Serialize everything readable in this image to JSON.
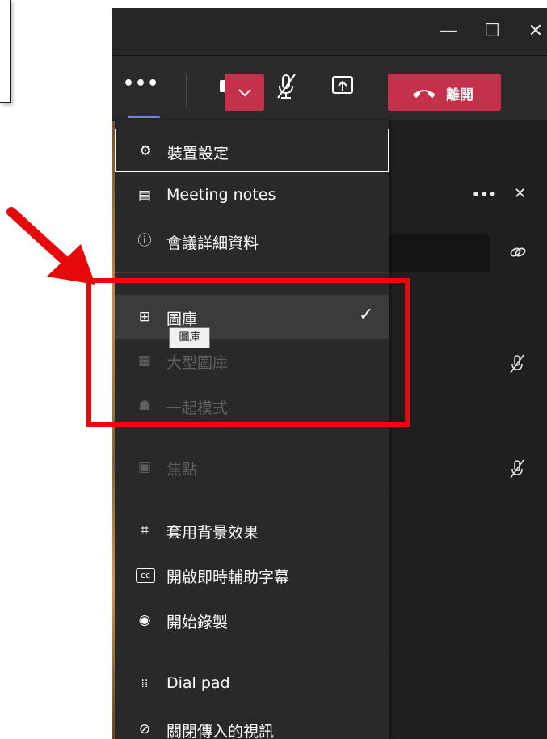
{
  "window": {
    "minimize_glyph": "—",
    "maximize_glyph": "☐",
    "close_glyph": "✕"
  },
  "toolbar": {
    "more_label": "•••",
    "leave_label": "離開"
  },
  "menu": {
    "items": [
      {
        "label": "裝置設定",
        "icon": "gear-icon"
      },
      {
        "label": "Meeting notes",
        "icon": "notes-icon"
      },
      {
        "label": "會議詳細資料",
        "icon": "info-icon"
      },
      {
        "label": "圖庫",
        "icon": "grid-icon",
        "selected": true
      },
      {
        "label": "大型圖庫",
        "icon": "large-grid-icon",
        "disabled": true
      },
      {
        "label": "一起模式",
        "icon": "together-icon",
        "disabled": true
      },
      {
        "label": "焦點",
        "icon": "focus-icon",
        "disabled": true
      },
      {
        "label": "套用背景效果",
        "icon": "background-effects-icon"
      },
      {
        "label": "開啟即時輔助字幕",
        "icon": "captions-icon"
      },
      {
        "label": "開始錄製",
        "icon": "record-icon"
      },
      {
        "label": "Dial pad",
        "icon": "dialpad-icon"
      },
      {
        "label": "關閉傳入的視訊",
        "icon": "video-off-icon"
      }
    ],
    "check_glyph": "✓"
  },
  "tooltip": {
    "text": "圖庫"
  },
  "participants_panel": {
    "more_label": "•••",
    "close_glyph": "✕"
  },
  "colors": {
    "accent": "#7f85f5",
    "leave": "#c4314b",
    "annotation": "#e5090b"
  }
}
